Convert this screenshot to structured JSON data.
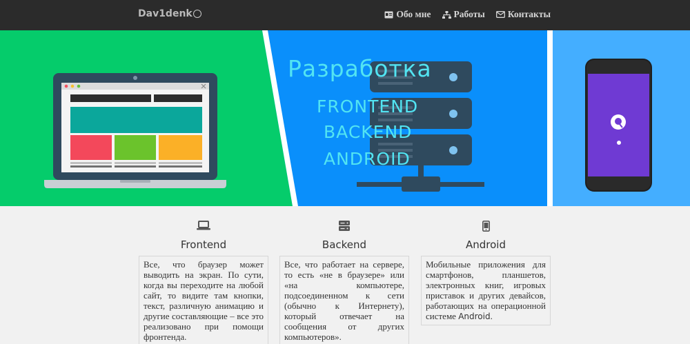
{
  "navbar": {
    "brand": "Dav1denk",
    "links": [
      {
        "icon": "id-card-icon",
        "label": "Обо мне"
      },
      {
        "icon": "sitemap-icon",
        "label": "Работы"
      },
      {
        "icon": "envelope-icon",
        "label": "Контакты"
      }
    ]
  },
  "hero": {
    "title": "Разработка",
    "items": [
      "FRONTEND",
      "BACKEND",
      "ANDROID"
    ],
    "colors": {
      "green": "#05cc6b",
      "blue": "#0a8ffb",
      "light_blue": "#44aeff",
      "text": "#52e4f2"
    }
  },
  "cards": [
    {
      "icon": "laptop-icon",
      "title": "Frontend",
      "text": "Все, что браузер может выводить на экран. По сути, когда вы переходите на любой сайт, то видите там кнопки, текст, различную анимацию и другие составляющие – все это реализовано при помощи фронтенда."
    },
    {
      "icon": "server-icon",
      "title": "Backend",
      "text": "Все, что работает на сервере, то есть «не в браузере» или «на компьютере, подсоединенном к сети (обычно к Интернету), который отвечает на сообщения от других компьютеров»."
    },
    {
      "icon": "mobile-icon",
      "title": "Android",
      "text_before": "Мобильные приложения для смартфонов, планшетов, электронных книг, игровых приставок и других девайсов, работающих на операционной системе ",
      "text_highlight": "Android",
      "text_after": "."
    }
  ]
}
